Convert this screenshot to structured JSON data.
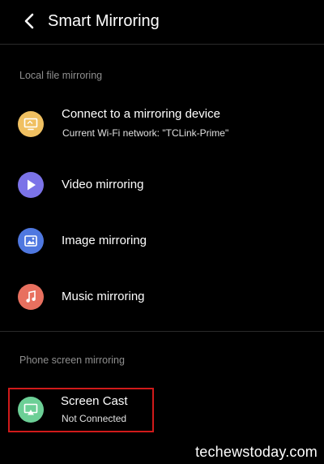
{
  "header": {
    "title": "Smart Mirroring"
  },
  "sections": {
    "local": {
      "label": "Local file mirroring",
      "items": [
        {
          "title": "Connect to a mirroring device",
          "subtitle": "Current Wi-Fi network: \"TCLink-Prime\"",
          "icon": "monitor-icon",
          "color": "#f0c061"
        },
        {
          "title": "Video mirroring",
          "icon": "play-icon",
          "color": "#7b73e8"
        },
        {
          "title": "Image mirroring",
          "icon": "image-icon",
          "color": "#4f78e0"
        },
        {
          "title": "Music mirroring",
          "icon": "music-note-icon",
          "color": "#e8705f"
        }
      ]
    },
    "phone": {
      "label": "Phone screen mirroring",
      "items": [
        {
          "title": "Screen Cast",
          "subtitle": "Not Connected",
          "icon": "screen-cast-icon",
          "color": "#6ccf96"
        }
      ]
    }
  },
  "highlight_color": "#d01a1a",
  "watermark": "techewstoday.com"
}
